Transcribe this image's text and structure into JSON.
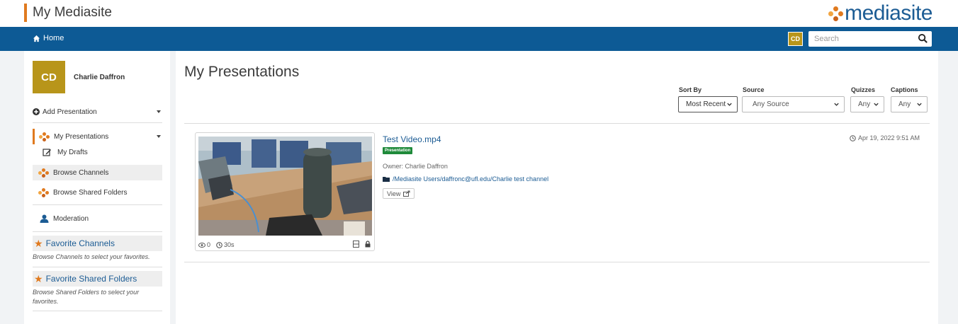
{
  "header": {
    "app_title": "My Mediasite",
    "logo_text": "mediasite",
    "accent_color": "#e07a1f",
    "brand_color": "#0d5a95"
  },
  "navbar": {
    "home_label": "Home",
    "user_initials": "CD",
    "search_placeholder": "Search"
  },
  "sidebar": {
    "user": {
      "initials": "CD",
      "name": "Charlie Daffron"
    },
    "add_presentation": "Add Presentation",
    "items": [
      {
        "label": "My Presentations",
        "icon": "mediasite-dots-icon",
        "active": true
      },
      {
        "label": "My Drafts",
        "icon": "edit-icon"
      },
      {
        "label": "Browse Channels",
        "icon": "mediasite-dots-icon"
      },
      {
        "label": "Browse Shared Folders",
        "icon": "mediasite-dots-icon"
      },
      {
        "label": "Moderation",
        "icon": "user-icon"
      }
    ],
    "favorites": [
      {
        "title": "Favorite Channels",
        "note": "Browse Channels to select your favorites."
      },
      {
        "title": "Favorite Shared Folders",
        "note": "Browse Shared Folders to select your favorites."
      }
    ]
  },
  "main": {
    "page_title": "My Presentations",
    "filters": [
      {
        "label": "Sort By",
        "value": "Most Recent"
      },
      {
        "label": "Source",
        "value": "Any Source"
      },
      {
        "label": "Quizzes",
        "value": "Any"
      },
      {
        "label": "Captions",
        "value": "Any"
      }
    ],
    "presentation": {
      "title": "Test Video.mp4",
      "badge": "Presentation",
      "owner": "Owner: Charlie Daffron",
      "path": "/Mediasite Users/daffronc@ufl.edu/Charlie test channel",
      "view_label": "View",
      "date": "Apr 19, 2022 9:51 AM",
      "views": "0",
      "duration": "30s"
    }
  }
}
